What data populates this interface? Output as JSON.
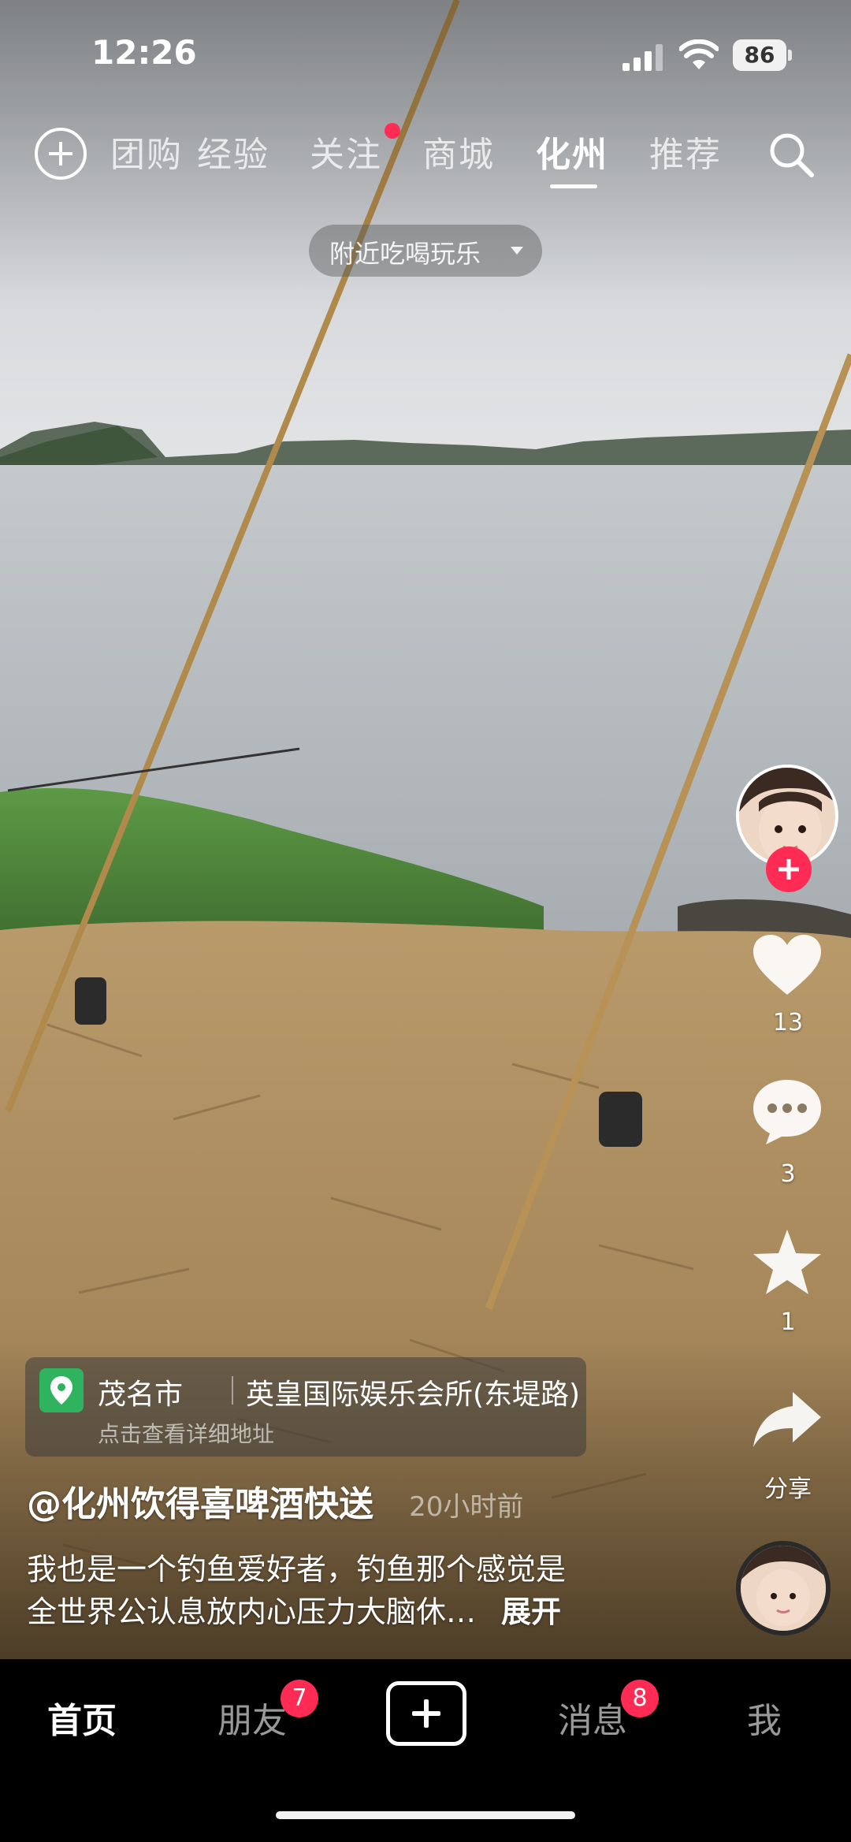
{
  "status_bar": {
    "time": "12:26",
    "battery": "86"
  },
  "top_nav": {
    "tabs": [
      {
        "label": "团购"
      },
      {
        "label": "经验"
      },
      {
        "label": "关注"
      },
      {
        "label": "商城"
      },
      {
        "label": "化州"
      },
      {
        "label": "推荐"
      }
    ],
    "active_tab": "化州",
    "nearby_pill": "附近吃喝玩乐"
  },
  "right_rail": {
    "like_count": "13",
    "comment_count": "3",
    "favorite_count": "1",
    "share_label": "分享"
  },
  "location": {
    "city": "茂名市",
    "place": "英皇国际娱乐会所(东堤路)",
    "hint": "点击查看详细地址"
  },
  "caption": {
    "author": "@化州饮得喜啤酒快送",
    "time": "20小时前",
    "line1": "我也是一个钓鱼爱好者，钓鱼那个感觉是",
    "line2": "全世界公认息放内心压力大脑休…",
    "expand": "展开"
  },
  "bottom_nav": {
    "home": "首页",
    "friends": "朋友",
    "friends_badge": "7",
    "messages": "消息",
    "messages_badge": "8",
    "me": "我"
  },
  "colors": {
    "accent": "#fe2c55",
    "location_green": "#2fb35e"
  }
}
